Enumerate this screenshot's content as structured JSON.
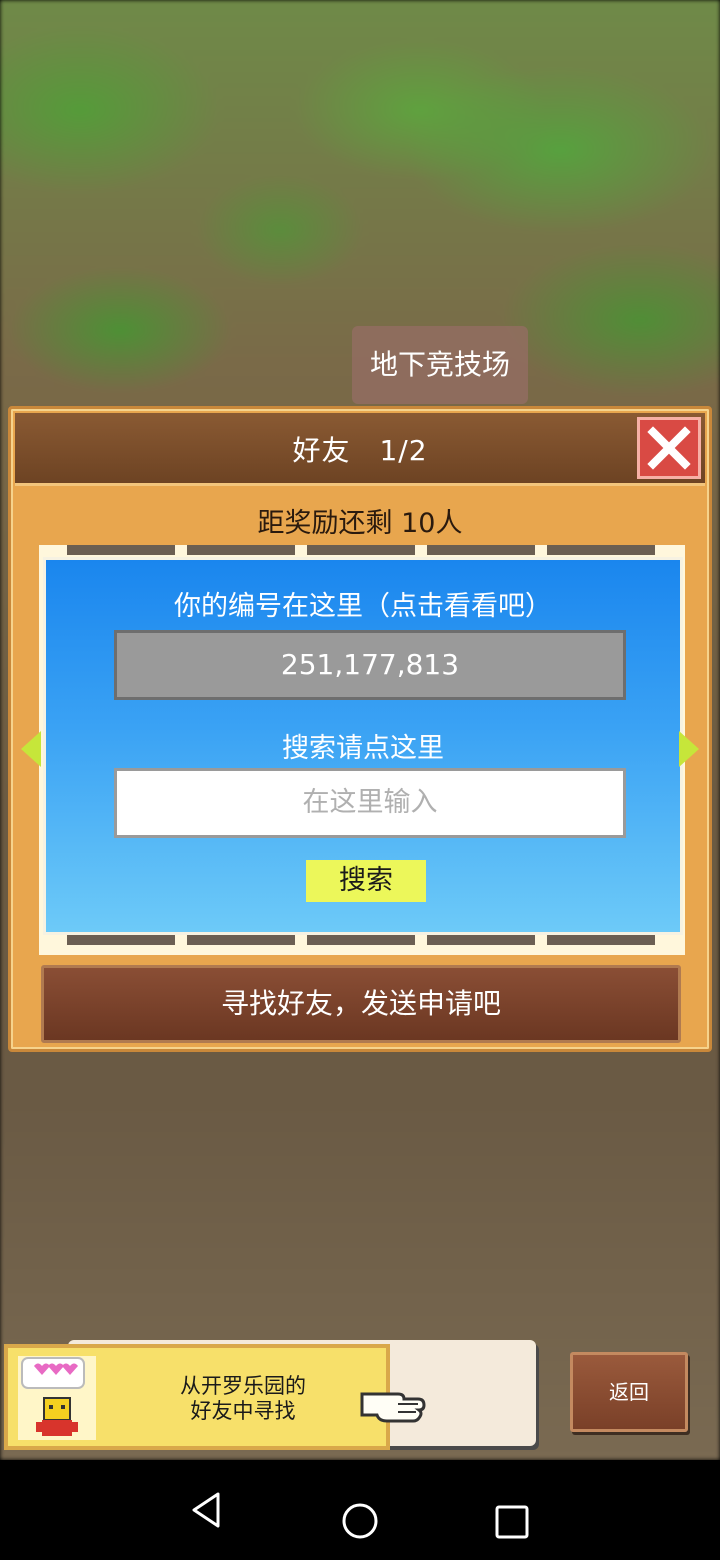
{
  "background": {
    "venue_label": "地下竞技场"
  },
  "dialog": {
    "title": "好友　1/2",
    "reward_text": "距奖励还剩 10人",
    "id_label": "你的编号在这里（点击看看吧）",
    "player_id": "251,177,813",
    "search_label": "搜索请点这里",
    "search_placeholder": "在这里输入",
    "search_button": "搜索",
    "find_friends_button": "寻找好友，发送申请吧"
  },
  "bottom": {
    "cairo_line1": "从开罗乐园的",
    "cairo_line2": "好友中寻找",
    "back_button": "返回"
  },
  "icons": {
    "close": "close-icon",
    "left_arrow": "arrow-left-icon",
    "right_arrow": "arrow-right-icon",
    "hand": "pointing-hand-icon",
    "character": "kairo-character-icon"
  },
  "colors": {
    "dialog_bg": "#e8a64e",
    "header_bg": "#7a4d2a",
    "panel_blue": "#1a86ee",
    "close_red": "#d94a44",
    "search_yellow": "#ecf75a"
  }
}
